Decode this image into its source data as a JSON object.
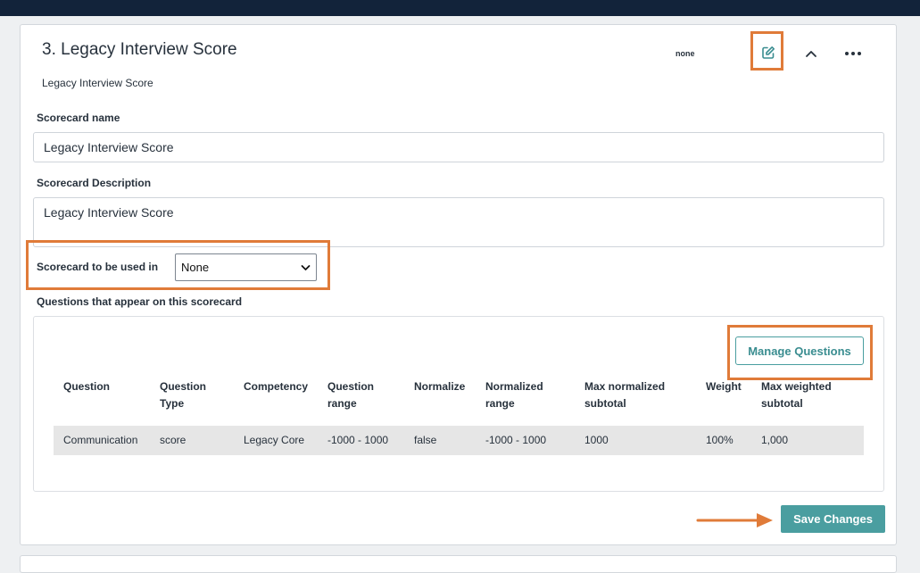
{
  "card": {
    "title": "3. Legacy Interview Score",
    "subtitle": "Legacy Interview Score",
    "status": "none",
    "edit_icon": "edit-icon",
    "collapse_icon": "chevron-up-icon",
    "more_icon": "more-horizontal-icon"
  },
  "form": {
    "name_label": "Scorecard name",
    "name_value": "Legacy Interview Score",
    "description_label": "Scorecard Description",
    "description_value": "Legacy Interview Score",
    "used_in_label": "Scorecard to be used in",
    "used_in_value": "None",
    "questions_label": "Questions that appear on this scorecard"
  },
  "questions": {
    "manage_button": "Manage Questions",
    "columns": [
      {
        "l1": "",
        "l2": "Question"
      },
      {
        "l1": "Question",
        "l2": "Type"
      },
      {
        "l1": "",
        "l2": "Competency"
      },
      {
        "l1": "Question",
        "l2": "range"
      },
      {
        "l1": "",
        "l2": "Normalize"
      },
      {
        "l1": "Normalized",
        "l2": "range"
      },
      {
        "l1": "Max normalized",
        "l2": "subtotal"
      },
      {
        "l1": "",
        "l2": "Weight"
      },
      {
        "l1": "Max weighted",
        "l2": "subtotal"
      }
    ],
    "rows": [
      [
        "Communication",
        "score",
        "Legacy Core",
        "-1000 - 1000",
        "false",
        "-1000 - 1000",
        "1000",
        "100%",
        "1,000"
      ]
    ]
  },
  "footer": {
    "save_button": "Save Changes"
  },
  "colors": {
    "accent": "#4a9ea0",
    "highlight": "#e07b39",
    "topbar": "#12233a"
  }
}
